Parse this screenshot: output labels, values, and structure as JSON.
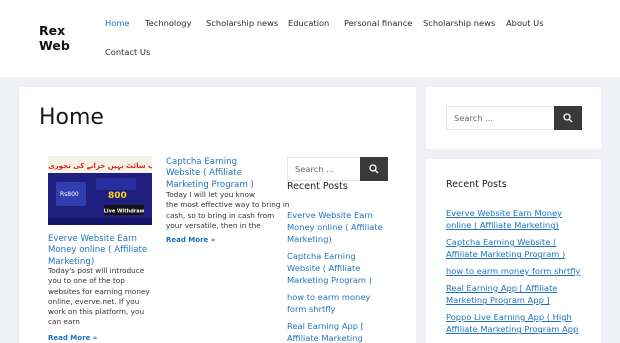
{
  "site": {
    "logo_line1": "Rex",
    "logo_line2": "Web"
  },
  "nav": [
    "Home",
    "Technology",
    "Scholarship news",
    "Education",
    "Personal finance",
    "Scholarship news",
    "About Us",
    "Contact Us"
  ],
  "page": {
    "title": "Home"
  },
  "posts": [
    {
      "title_lines": [
        "Captcha Earning",
        "Website ( Affiliate",
        "Marketing Program )"
      ],
      "excerpt_lines": [
        "Today I will let you know",
        "the most effective way to bring in",
        "cash, so to bring in cash from",
        "your versatile, then in the"
      ],
      "read_more": "Read More »"
    },
    {
      "title_lines": [
        "Everve Website Earn",
        "Money online ( Affiliate",
        "Marketing)"
      ],
      "excerpt_lines": [
        "Today's post will introduce",
        "you to one of the top",
        "websites for earning money",
        "online, everve.net. If you",
        "work on this platform, you",
        "can earn"
      ],
      "read_more": "Read More »"
    }
  ],
  "thumbnail": {
    "headline_urdu": "ویب سائٹ نہیں خزانے کی تجوری ہے",
    "amount_small": "Rs800",
    "amount_big": "800",
    "badge": "Live Withdraw"
  },
  "middle_widget": {
    "search_placeholder": "Search ...",
    "recent_title": "Recent Posts",
    "links": [
      [
        "Everve Website Earn",
        "Money online ( Affiliate",
        "Marketing)"
      ],
      [
        "Captcha Earning",
        "Website ( Affiliate",
        "Marketing Program )"
      ],
      [
        "how to earm money",
        "form shrtfly"
      ],
      [
        "Real Earning App [",
        "Affiliate Marketing"
      ]
    ]
  },
  "sidebar": {
    "search_placeholder": "Search ...",
    "recent_title": "Recent Posts",
    "links": [
      [
        "Everve Website Earn Money",
        "online ( Affiliate Marketing)"
      ],
      [
        "Captcha Earning Website (",
        "Affiliate Marketing Program )"
      ],
      [
        "how to earm money form shrtfly"
      ],
      [
        "Real Earning App [ Affiliate",
        "Marketing Program App ]"
      ],
      [
        "Poppo Live Earning App ( High",
        "Affiliate Marketing Program App"
      ]
    ]
  },
  "colors": {
    "accent": "#1e73be",
    "button": "#3a3a3a",
    "background": "#eef0f3"
  },
  "icons": {
    "search": "search-icon"
  }
}
